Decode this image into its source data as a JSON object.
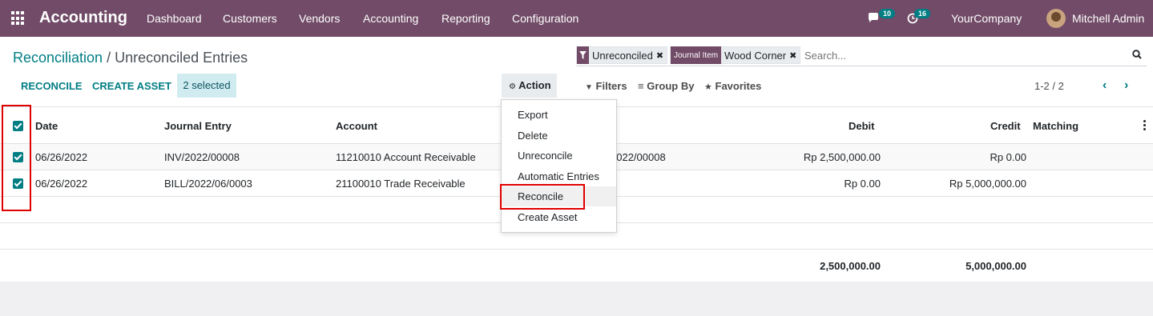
{
  "navbar": {
    "brand": "Accounting",
    "menu": [
      "Dashboard",
      "Customers",
      "Vendors",
      "Accounting",
      "Reporting",
      "Configuration"
    ],
    "messages_count": "10",
    "activities_count": "16",
    "company": "YourCompany",
    "user": "Mitchell Admin",
    "colors": {
      "bar": "#714b67",
      "badge": "#017e84"
    }
  },
  "breadcrumb": {
    "parent": "Reconciliation",
    "separator": " / ",
    "current": "Unreconciled Entries"
  },
  "buttons": {
    "reconcile": "RECONCILE",
    "create_asset": "CREATE ASSET",
    "selected": "2 selected",
    "action": "Action"
  },
  "search": {
    "facets": [
      {
        "label": "",
        "value": "Unreconciled",
        "icon": "filter-icon"
      },
      {
        "label": "Journal Item",
        "value": "Wood Corner",
        "icon": ""
      }
    ],
    "placeholder": "Search..."
  },
  "filters": {
    "filters": "Filters",
    "group_by": "Group By",
    "favorites": "Favorites"
  },
  "pager": {
    "value": "1-2 / 2"
  },
  "table": {
    "columns": [
      "Date",
      "Journal Entry",
      "Account",
      "Debit",
      "Credit",
      "Matching"
    ],
    "rows": [
      {
        "date": "06/26/2022",
        "journal_entry": "INV/2022/00008",
        "account": "11210010 Account Receivable",
        "label": "2022/00008",
        "debit": "Rp 2,500,000.00",
        "credit": "Rp 0.00",
        "matching": ""
      },
      {
        "date": "06/26/2022",
        "journal_entry": "BILL/2022/06/0003",
        "account": "21100010 Trade Receivable",
        "label": "",
        "debit": "Rp 0.00",
        "credit": "Rp 5,000,000.00",
        "matching": ""
      }
    ],
    "totals": {
      "debit": "2,500,000.00",
      "credit": "5,000,000.00"
    }
  },
  "action_menu": [
    "Export",
    "Delete",
    "Unreconcile",
    "Automatic Entries",
    "Reconcile",
    "Create Asset"
  ],
  "highlight_color": "#e10000"
}
